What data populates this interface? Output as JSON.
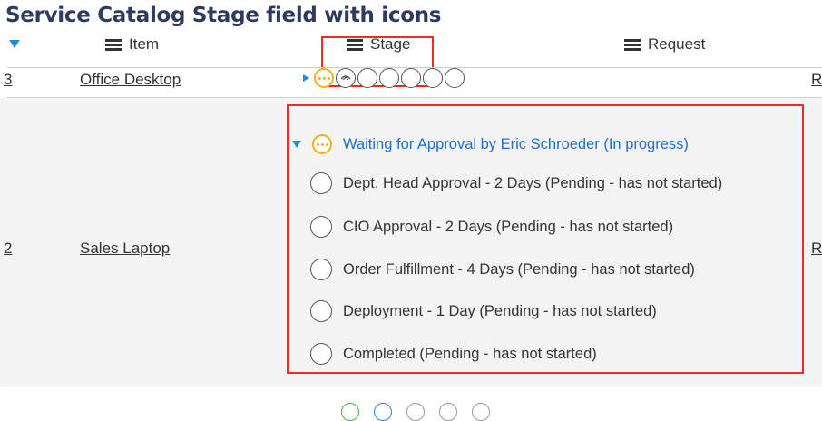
{
  "title": "Service Catalog Stage field with icons",
  "columns": {
    "item": "Item",
    "stage": "Stage",
    "request": "Request"
  },
  "rows": [
    {
      "number_fragment": "3",
      "item": "Office Desktop",
      "request_fragment": "R"
    },
    {
      "number_fragment": "2",
      "item": "Sales Laptop",
      "request_fragment": "R"
    }
  ],
  "stages": {
    "current": "Waiting for Approval by Eric Schroeder (In progress)",
    "items": [
      "Dept. Head Approval - 2 Days (Pending - has not started)",
      "CIO Approval - 2 Days (Pending - has not started)",
      "Order Fulfillment - 4 Days (Pending - has not started)",
      "Deployment - 1 Day (Pending - has not started)",
      "Completed (Pending - has not started)"
    ]
  },
  "colors": {
    "highlight": "#ee2b2b",
    "link_blue": "#1f6fd0",
    "in_progress_yellow": "#f5b21a",
    "title_navy": "#2f3a60"
  }
}
